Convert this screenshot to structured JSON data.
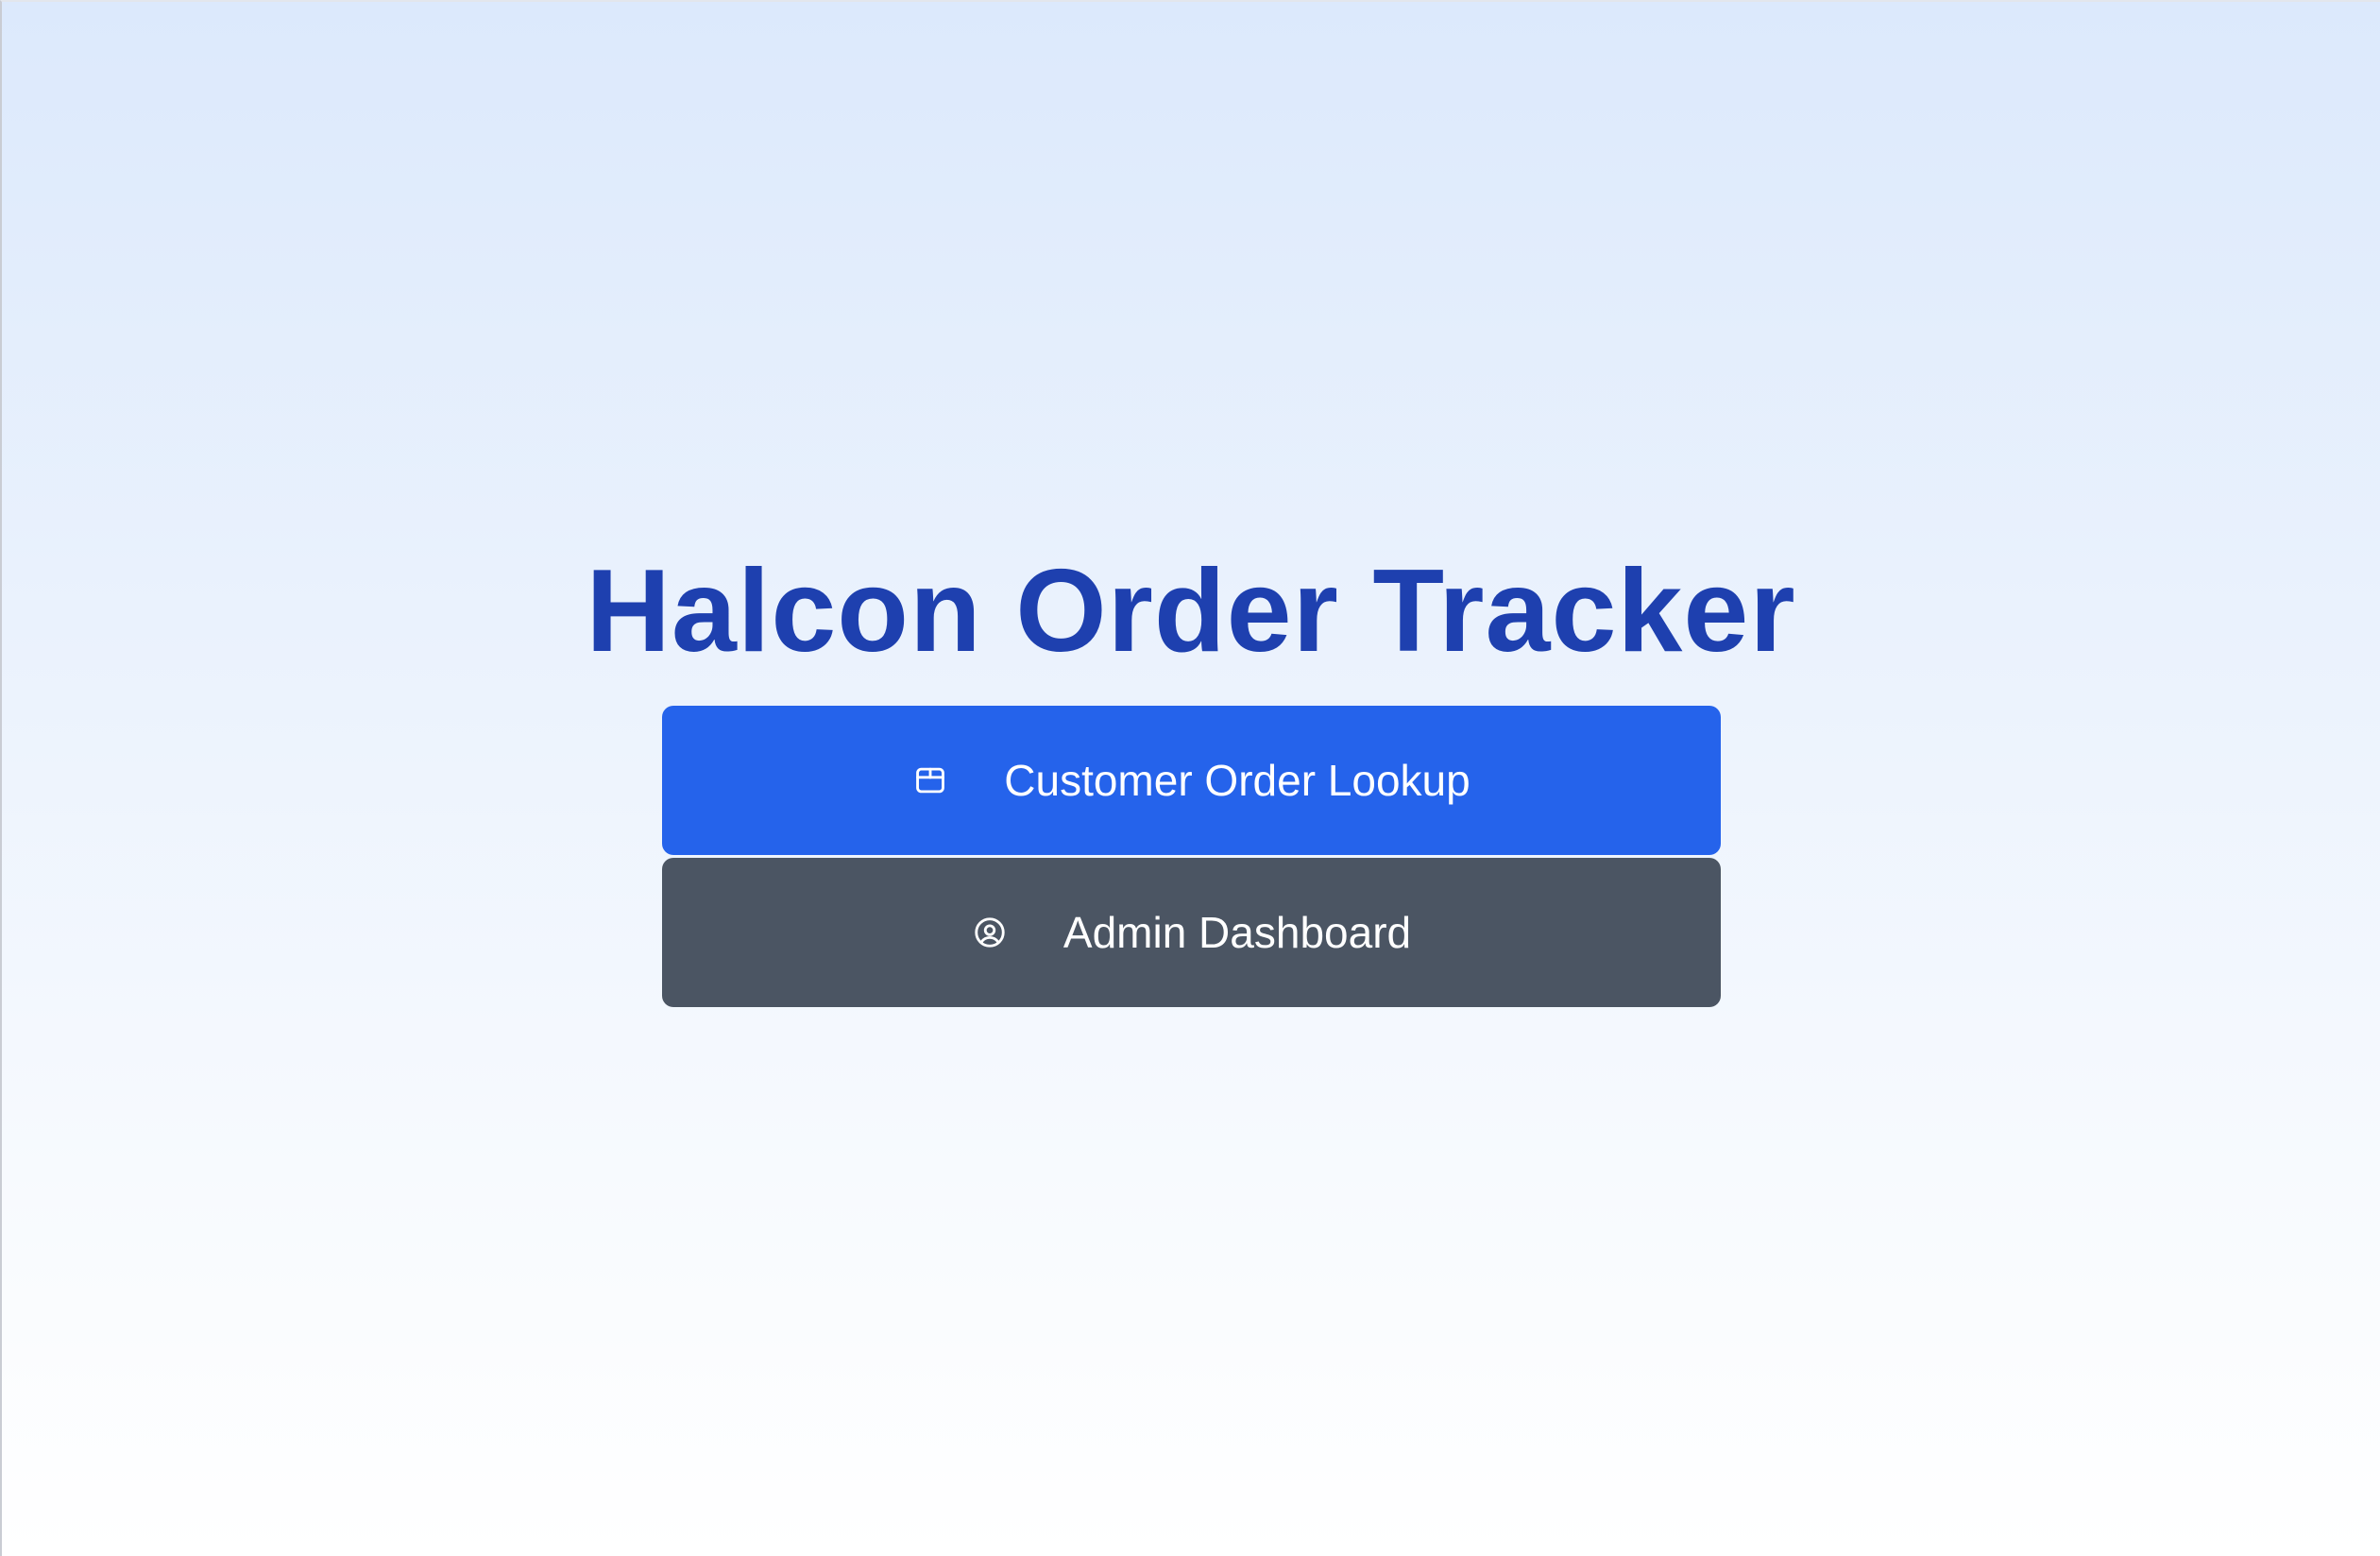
{
  "page": {
    "title": "Halcon Order Tracker"
  },
  "buttons": {
    "customer_lookup": {
      "label": "Customer Order Lookup",
      "icon": "package-icon"
    },
    "admin_dashboard": {
      "label": "Admin Dashboard",
      "icon": "user-circle-icon"
    }
  },
  "colors": {
    "title": "#1e40af",
    "primary_button": "#2563eb",
    "secondary_button": "#4b5563",
    "background_top": "#dce9fc",
    "background_bottom": "#ffffff"
  }
}
